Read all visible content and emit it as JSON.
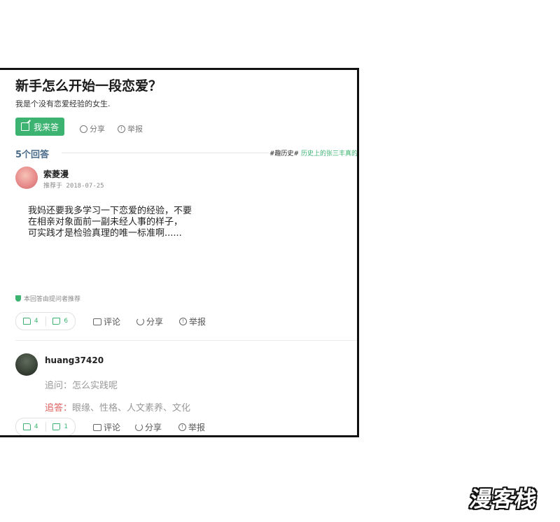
{
  "question": {
    "title": "新手怎么开始一段恋爱？",
    "description": "我是个没有恋爱经验的女生.",
    "answer_button": "我来答",
    "share": "分享",
    "report": "举报"
  },
  "answers_count": "5个回答",
  "tags": {
    "tag1": "#趣历史#",
    "tag2": "历史上的张三丰真的"
  },
  "answer1": {
    "user": "索菱漫",
    "recommended_on": "推荐于 2018-07-25",
    "text_lines": [
      "我妈还要我多学习一下恋爱的经验，不要",
      "在相亲对象面前一副未经人事的样子，",
      "可实践才是检验真理的唯一标准啊......"
    ],
    "recommend_note": "本回答由提问者推荐",
    "likes": "4",
    "dislikes": "6",
    "comment": "评论",
    "share": "分享",
    "report": "举报"
  },
  "answer2": {
    "user": "huang37420",
    "follow_question_label": "追问：",
    "follow_question": "怎么实践呢",
    "follow_answer_label": "追答：",
    "follow_answer": "眼缘、性格、人文素养、文化",
    "likes": "4",
    "dislikes": "1",
    "comment": "评论",
    "share": "分享",
    "report": "举报"
  },
  "watermark": "漫客栈"
}
